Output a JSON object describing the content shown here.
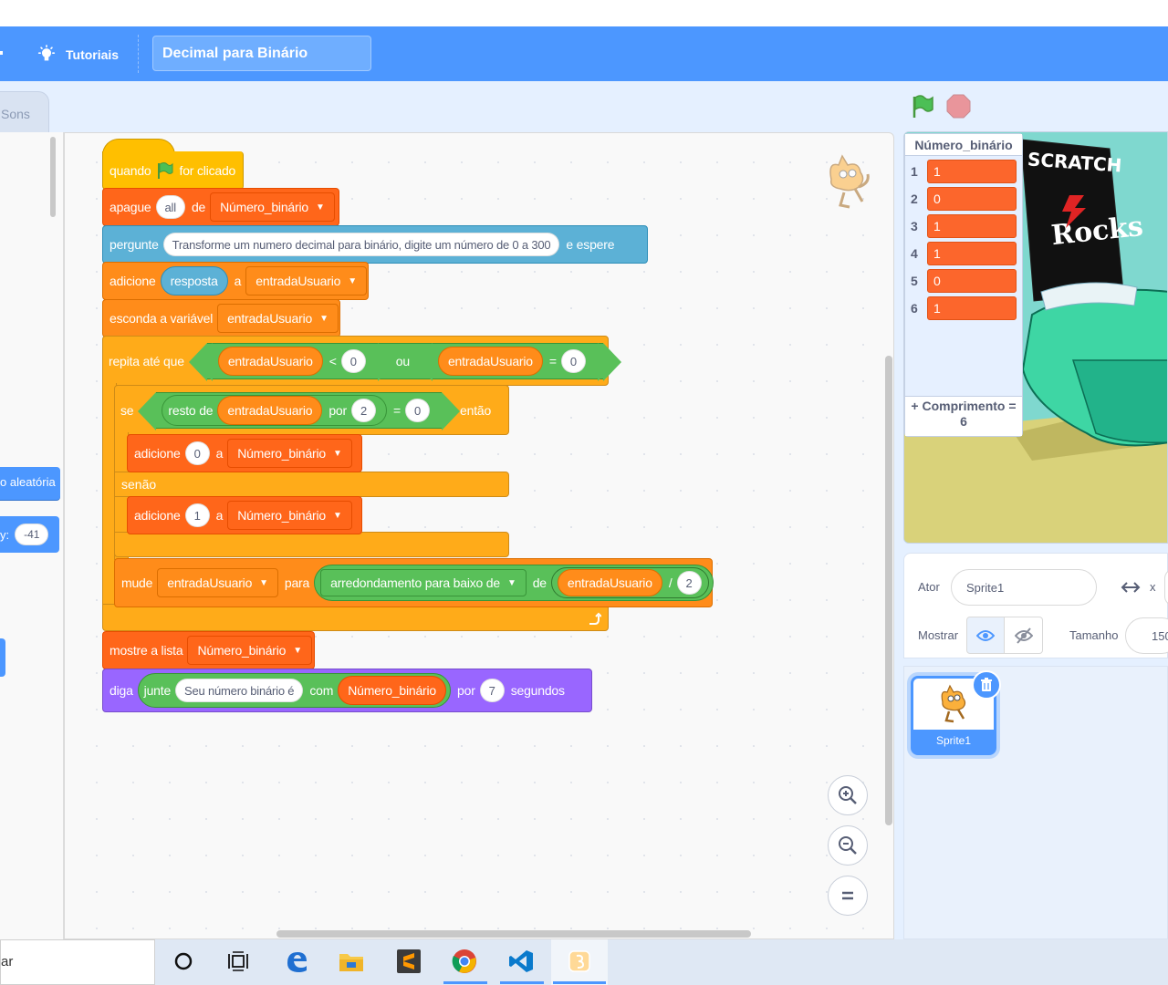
{
  "menubar": {
    "tutorials_label": "Tutoriais",
    "project_title": "Decimal para Binário",
    "color": "#4c97ff"
  },
  "tabs": {
    "sounds_label": "Sons"
  },
  "palette": {
    "random_block_text": "o aleatória",
    "y_label": "y:",
    "y_value": "-41"
  },
  "blocks": {
    "hat": {
      "when": "quando",
      "clicked": "for clicado"
    },
    "delete": {
      "label": "apague",
      "all": "all",
      "of": "de",
      "list": "Número_binário"
    },
    "ask": {
      "label": "pergunte",
      "question": "Transforme um numero decimal para binário, digite um número de 0 a 300",
      "wait": "e espere"
    },
    "add_answer": {
      "label": "adicione",
      "answer": "resposta",
      "to": "a",
      "list": "entradaUsuario"
    },
    "hide_var": {
      "label": "esconda a variável",
      "var": "entradaUsuario"
    },
    "repeat_until": {
      "label": "repita até que",
      "var1": "entradaUsuario",
      "lt": "<",
      "zero1": "0",
      "or": "ou",
      "var2": "entradaUsuario",
      "eq": "=",
      "zero2": "0"
    },
    "if": {
      "label": "se",
      "mod": "resto de",
      "var": "entradaUsuario",
      "by": "por",
      "two": "2",
      "eq": "=",
      "zero": "0",
      "then": "então"
    },
    "add0": {
      "label": "adicione",
      "value": "0",
      "to": "a",
      "list": "Número_binário"
    },
    "else": "senão",
    "add1": {
      "label": "adicione",
      "value": "1",
      "to": "a",
      "list": "Número_binário"
    },
    "change": {
      "label": "mude",
      "var": "entradaUsuario",
      "to": "para",
      "floor": "arredondamento para baixo de",
      "of": "de",
      "var2": "entradaUsuario",
      "div": "/",
      "two": "2"
    },
    "show_list": {
      "label": "mostre a lista",
      "list": "Número_binário"
    },
    "say": {
      "label": "diga",
      "join": "junte",
      "text": "Seu número binário é",
      "with": "com",
      "list": "Número_binário",
      "for": "por",
      "secs": "7",
      "seconds": "segundos"
    }
  },
  "stage": {
    "list_monitor": {
      "title": "Número_binário",
      "items": [
        {
          "index": "1",
          "value": "1"
        },
        {
          "index": "2",
          "value": "0"
        },
        {
          "index": "3",
          "value": "1"
        },
        {
          "index": "4",
          "value": "1"
        },
        {
          "index": "5",
          "value": "0"
        },
        {
          "index": "6",
          "value": "1"
        }
      ],
      "length_label": "+ Comprimento =",
      "length_value": "6"
    },
    "poster_line1": "SCRATCH",
    "poster_line2": "Rocks"
  },
  "sprite_info": {
    "actor_label": "Ator",
    "actor_name": "Sprite1",
    "x_label": "x",
    "show_label": "Mostrar",
    "size_label": "Tamanho",
    "size_value": "150"
  },
  "sprites": [
    {
      "name": "Sprite1"
    }
  ],
  "taskbar": {
    "search_text": "ar"
  }
}
